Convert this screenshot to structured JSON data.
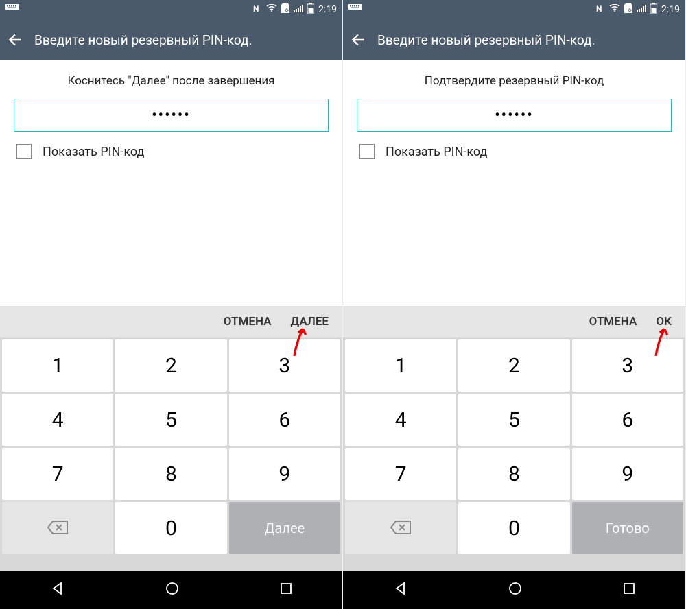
{
  "screens": [
    {
      "status": {
        "time": "2:19"
      },
      "title": "Введите новый резервный PIN-код.",
      "instruction": "Коснитесь \"Далее\" после завершения",
      "pin_display": "••••••",
      "show_pin_label": "Показать PIN-код",
      "cancel_label": "ОТМЕНА",
      "confirm_label": "ДАЛЕЕ",
      "keypad": {
        "r1": [
          "1",
          "2",
          "3"
        ],
        "r2": [
          "4",
          "5",
          "6"
        ],
        "r3": [
          "7",
          "8",
          "9"
        ],
        "zero": "0",
        "done": "Далее"
      }
    },
    {
      "status": {
        "time": "2:19"
      },
      "title": "Введите новый резервный PIN-код.",
      "instruction": "Подтвердите резервный PIN-код",
      "pin_display": "••••••",
      "show_pin_label": "Показать PIN-код",
      "cancel_label": "ОТМЕНА",
      "confirm_label": "ОК",
      "keypad": {
        "r1": [
          "1",
          "2",
          "3"
        ],
        "r2": [
          "4",
          "5",
          "6"
        ],
        "r3": [
          "7",
          "8",
          "9"
        ],
        "zero": "0",
        "done": "Готово"
      }
    }
  ]
}
